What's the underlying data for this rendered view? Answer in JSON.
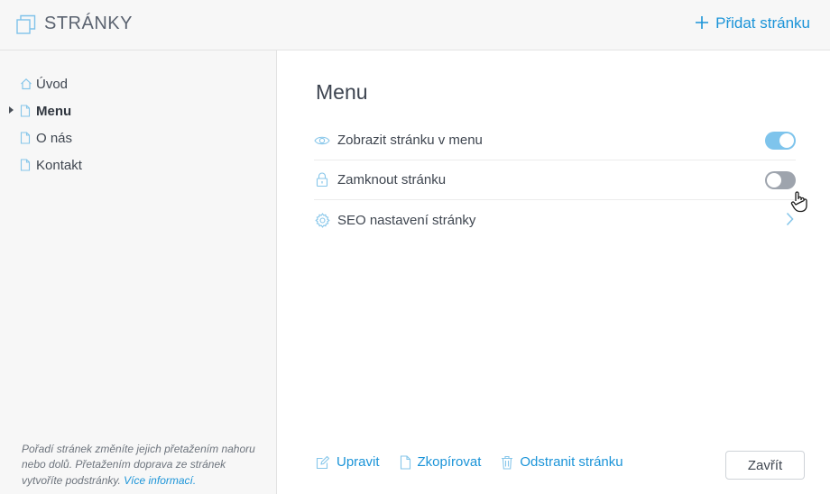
{
  "header": {
    "title": "STRÁNKY",
    "add_page_label": "Přidat stránku",
    "icon": "pages-icon",
    "add_icon": "plus-icon"
  },
  "sidebar": {
    "items": [
      {
        "label": "Úvod",
        "icon": "home-icon",
        "active": false
      },
      {
        "label": "Menu",
        "icon": "page-icon",
        "active": true
      },
      {
        "label": "O nás",
        "icon": "page-icon",
        "active": false
      },
      {
        "label": "Kontakt",
        "icon": "page-icon",
        "active": false
      }
    ],
    "help_text": "Pořadí stránek změníte jejich přetažením nahoru nebo dolů. Přetažením doprava ze stránek vytvoříte podstránky.",
    "help_link": "Více informací."
  },
  "main": {
    "title": "Menu",
    "settings": [
      {
        "label": "Zobrazit stránku v menu",
        "icon": "eye-icon",
        "control": "toggle",
        "state": "on"
      },
      {
        "label": "Zamknout stránku",
        "icon": "lock-icon",
        "control": "toggle",
        "state": "off"
      },
      {
        "label": "SEO nastavení stránky",
        "icon": "gear-icon",
        "control": "chevron"
      }
    ],
    "actions": [
      {
        "label": "Upravit",
        "icon": "edit-icon"
      },
      {
        "label": "Zkopírovat",
        "icon": "copy-icon"
      },
      {
        "label": "Odstranit stránku",
        "icon": "trash-icon"
      }
    ],
    "close_label": "Zavřít"
  },
  "colors": {
    "accent": "#1b94d8",
    "toggle_on": "#7ec4ec",
    "toggle_off": "#9ea4ad",
    "sidebar_bg": "#f7f7f7"
  }
}
